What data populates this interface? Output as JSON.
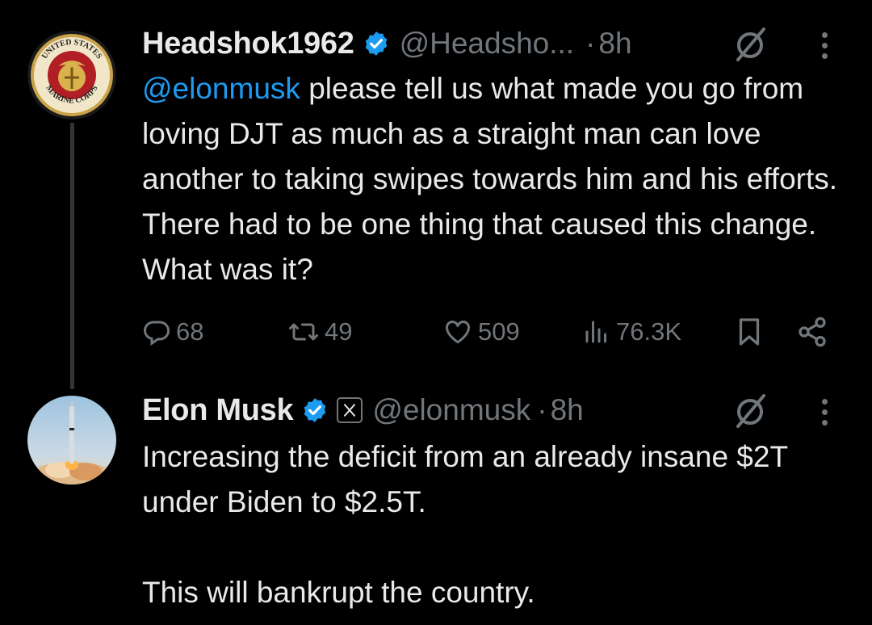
{
  "tweets": [
    {
      "name": "Headshok1962",
      "handle": "@Headsho...",
      "dot": "·",
      "time": "8h",
      "avatar_icon": "marine-corps-emblem-icon",
      "avatar_text_top": "UNITED STATES",
      "avatar_text_bottom": "MARINE CORPS",
      "mention": "@elonmusk",
      "text": " please tell us what made you go from loving DJT as much as a straight man can love another to taking swipes towards him and his efforts.  There had to be one thing that caused this change.  What was it?",
      "stats": {
        "replies": "68",
        "reposts": "49",
        "likes": "509",
        "views": "76.3K"
      }
    },
    {
      "name": "Elon Musk",
      "handle": "@elonmusk",
      "dot": "·",
      "time": "8h",
      "avatar_icon": "rocket-launch-icon",
      "affiliate_icon": "x-logo-icon",
      "text": "Increasing the deficit from an already insane $2T under Biden to $2.5T.\n\nThis will bankrupt the country."
    }
  ],
  "colors": {
    "background": "#000000",
    "text": "#e7e9ea",
    "muted": "#71767b",
    "accent": "#1d9bf0"
  }
}
